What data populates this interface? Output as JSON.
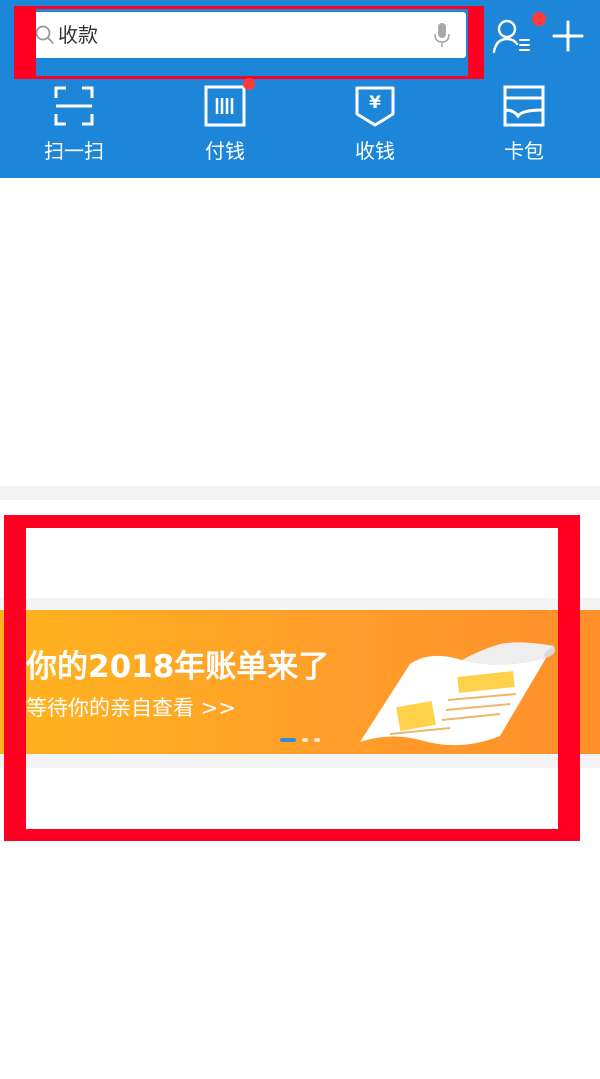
{
  "search": {
    "text": "收款"
  },
  "quick_actions": [
    {
      "label": "扫一扫",
      "icon": "scan-icon"
    },
    {
      "label": "付钱",
      "icon": "pay-barcode-icon"
    },
    {
      "label": "收钱",
      "icon": "receive-money-icon"
    },
    {
      "label": "卡包",
      "icon": "card-wallet-icon"
    }
  ],
  "header_icons": {
    "contacts": "contacts-icon",
    "add": "plus-icon"
  },
  "banner": {
    "title": "你的2018年账单来了",
    "subtitle": "等待你的亲自查看 >>",
    "slides_total": 3,
    "slide_active": 1
  },
  "colors": {
    "header_blue": "#1e86d8",
    "badge_red": "#ff3b3b",
    "banner_orange": "#ff9e2a",
    "annotation_red": "#ff0022"
  }
}
